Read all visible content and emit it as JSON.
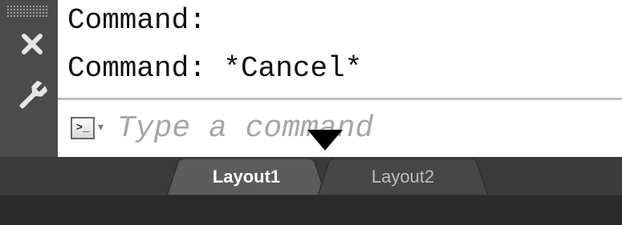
{
  "command_line": {
    "history": [
      "Command:",
      "Command: *Cancel*"
    ],
    "input": {
      "value": "",
      "placeholder": "Type a command"
    },
    "prompt_icon": {
      "name": "command-prompt-icon",
      "glyph": ">_"
    },
    "prompt_caret": "▾",
    "close_icon": "close-icon",
    "customize_icon": "wrench-icon"
  },
  "layout_tabs": [
    {
      "label": "Layout1",
      "active": true
    },
    {
      "label": "Layout2",
      "active": false
    }
  ],
  "colors": {
    "panel_dark": "#4b4b4b",
    "tab_bar": "#3b3b3b",
    "active_tab": "#5a5a5a",
    "inactive_tab": "#474747"
  }
}
